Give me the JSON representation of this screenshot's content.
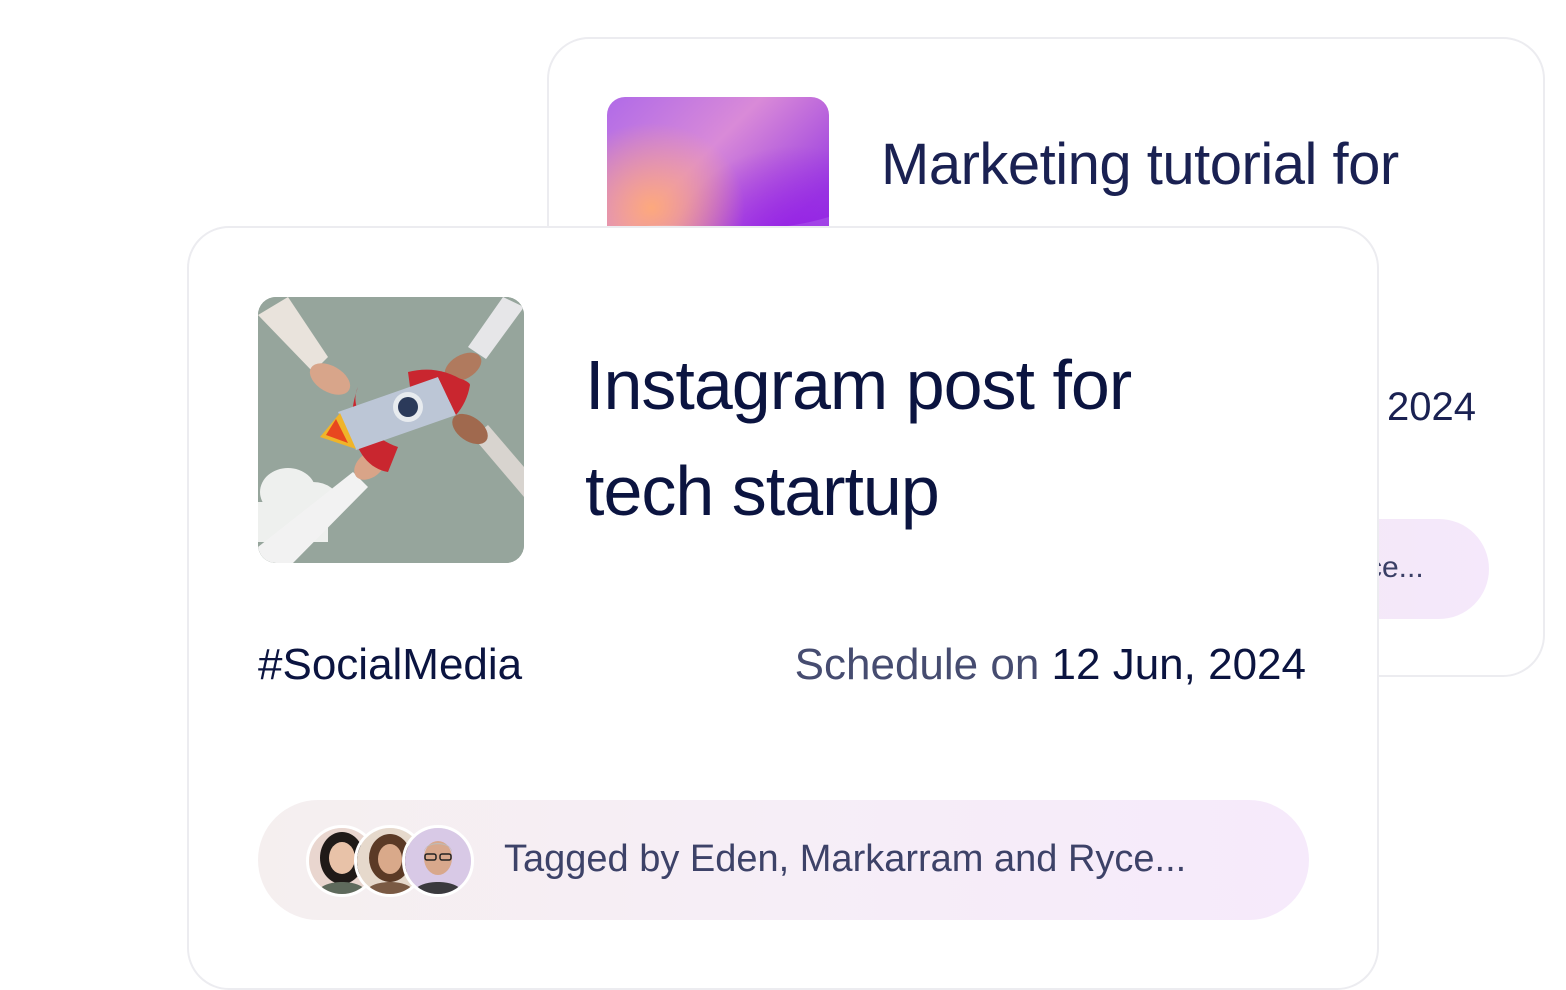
{
  "back_card": {
    "title": "Marketing tutorial for",
    "date_fragment": "2024",
    "tag_fragment": "ce..."
  },
  "front_card": {
    "title_line1": "Instagram post for",
    "title_line2": "tech startup",
    "hashtag": "#SocialMedia",
    "schedule_label": "Schedule on",
    "schedule_date": "12 Jun, 2024",
    "tagged_text": "Tagged by Eden, Markarram and Ryce..."
  },
  "colors": {
    "title": "#0b1440",
    "muted": "#464c70",
    "pill_start": "#f5efef",
    "pill_end": "#f6eafb",
    "card_border": "#ececf0"
  },
  "icons": {
    "front_thumbnail": "rocket-teamwork-photo",
    "back_thumbnail": "purple-gradient-art",
    "avatars": [
      "avatar-eden",
      "avatar-markarram",
      "avatar-ryce"
    ]
  }
}
